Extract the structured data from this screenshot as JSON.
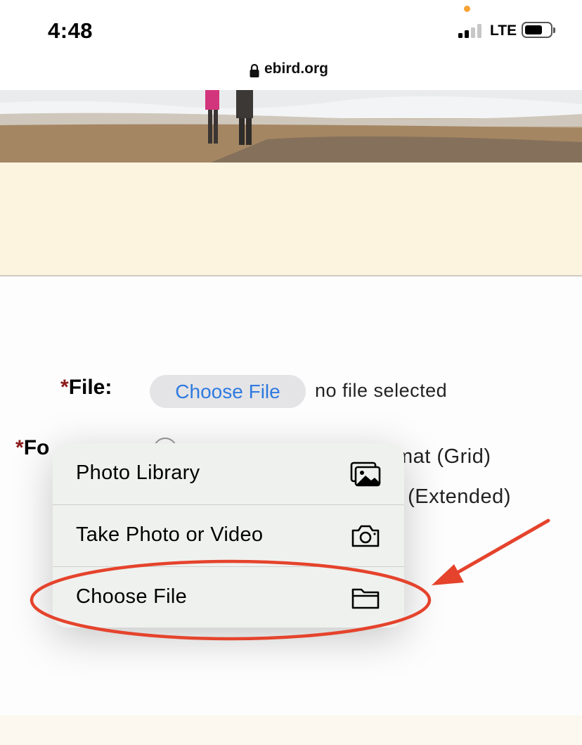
{
  "status_bar": {
    "time": "4:48",
    "network": "LTE"
  },
  "address_bar": {
    "url": "ebird.org",
    "lock_icon": "lock-icon"
  },
  "colors": {
    "link_blue": "#2f7ae0",
    "required_red": "#8b1a1a",
    "annotation_red": "#e5432c",
    "banner_cream": "#fdf4df"
  },
  "form": {
    "file_label": "File:",
    "required_mark": "*",
    "choose_file_button": "Choose File",
    "file_status": "no file selected",
    "format_label_partial": "Fo",
    "format_options_partial": [
      "mat (Grid)",
      "t (Extended)"
    ]
  },
  "menu": {
    "items": [
      {
        "label": "Photo Library",
        "icon": "photo-library-icon"
      },
      {
        "label": "Take Photo or Video",
        "icon": "camera-icon"
      },
      {
        "label": "Choose File",
        "icon": "folder-icon"
      }
    ]
  },
  "annotation": {
    "shape": "ellipse-around-choose-file",
    "arrow": "arrow-pointing-to-choose-file"
  }
}
